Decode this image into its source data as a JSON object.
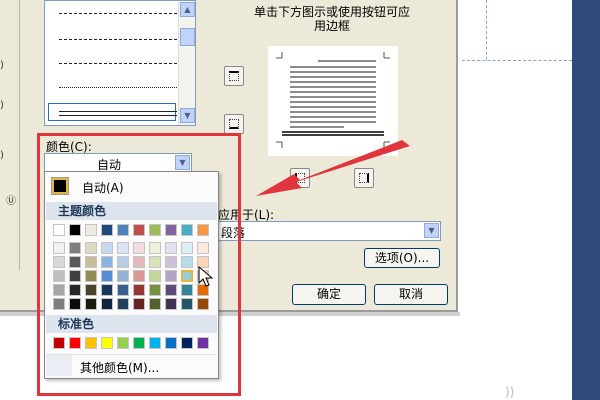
{
  "dialog": {
    "preview_hint": "单击下方图示或使用按钮可应用边框",
    "color_label": "颜色(C):",
    "color_value": "自动",
    "apply_label": "应用于(L):",
    "apply_value": "段落",
    "options_button": "选项(O)...",
    "ok_button": "确定",
    "cancel_button": "取消"
  },
  "palette": {
    "auto_label": "自动(A)",
    "theme_header": "主题颜色",
    "theme_top": [
      "#ffffff",
      "#000000",
      "#eeece1",
      "#1f497d",
      "#4f81bd",
      "#c0504d",
      "#9bbb59",
      "#8064a2",
      "#4bacc6",
      "#f79646"
    ],
    "theme_shades": [
      [
        "#f2f2f2",
        "#7f7f7f",
        "#ddd9c3",
        "#c6d9f0",
        "#dbe5f1",
        "#f2dcdb",
        "#ebf1dd",
        "#e5e0ec",
        "#dbeef3",
        "#fdeada"
      ],
      [
        "#d8d8d8",
        "#595959",
        "#c4bd97",
        "#8db3e2",
        "#b8cce4",
        "#e5b9b7",
        "#d7e3bc",
        "#ccc1d9",
        "#b7dde8",
        "#fbd5b5"
      ],
      [
        "#bfbfbf",
        "#3f3f3f",
        "#938953",
        "#548dd4",
        "#95b3d7",
        "#d99694",
        "#c3d69b",
        "#b2a2c7",
        "#92cddc",
        "#fac08f"
      ],
      [
        "#a5a5a5",
        "#262626",
        "#494429",
        "#17365d",
        "#366092",
        "#953734",
        "#76923c",
        "#5f497a",
        "#31859b",
        "#e36c09"
      ],
      [
        "#7f7f7f",
        "#0c0c0c",
        "#1d1b10",
        "#0f243e",
        "#244061",
        "#632423",
        "#4f6128",
        "#3f3151",
        "#205867",
        "#974806"
      ]
    ],
    "standard_header": "标准色",
    "standard_colors": [
      "#c00000",
      "#ff0000",
      "#ffc000",
      "#ffff00",
      "#92d050",
      "#00b050",
      "#00b0f0",
      "#0070c0",
      "#002060",
      "#7030a0"
    ],
    "more_colors": "其他颜色(M)..."
  },
  "colors": {
    "highlight_frame": "#e0353c",
    "annotation_arrow": "#e0353c"
  }
}
